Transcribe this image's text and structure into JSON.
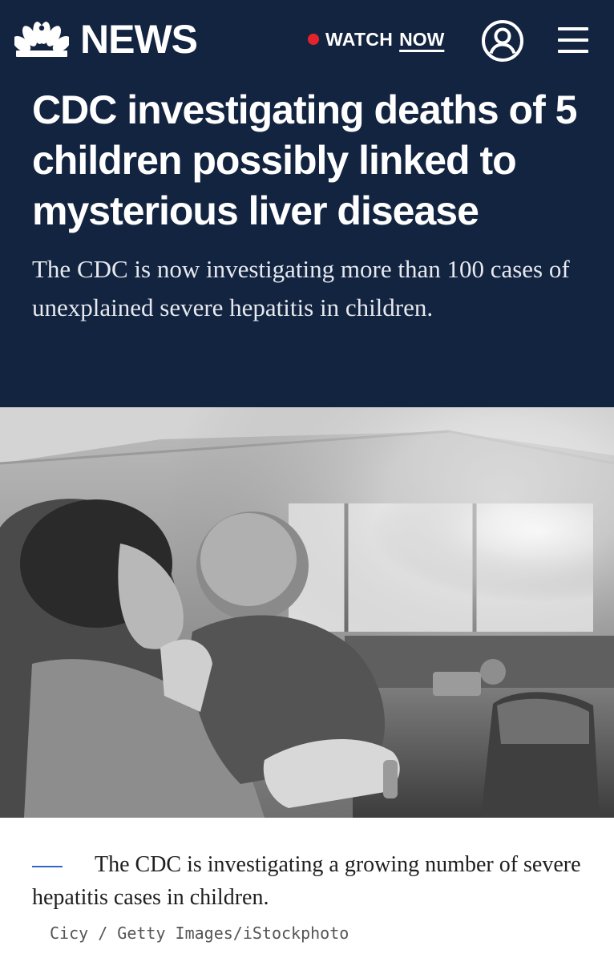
{
  "header": {
    "brand_name": "NEWS",
    "watch_label": "WATCH",
    "watch_now": "NOW",
    "live_dot_color": "#e4242c",
    "background_color": "#132440",
    "icons": {
      "logo": "nbc-peacock-icon",
      "account": "user-circle-icon",
      "menu": "hamburger-menu-icon"
    }
  },
  "article": {
    "headline": "CDC investigating deaths of 5 children possibly linked to mysterious liver disease",
    "dek": "The CDC is now investigating more than 100 cases of unexplained severe hepatitis in children."
  },
  "photo": {
    "caption": "The CDC is investigating a growing number of severe hepatitis cases in children.",
    "credit": "Cicy / Getty Images/iStockphoto",
    "accent_color": "#3466c8"
  }
}
